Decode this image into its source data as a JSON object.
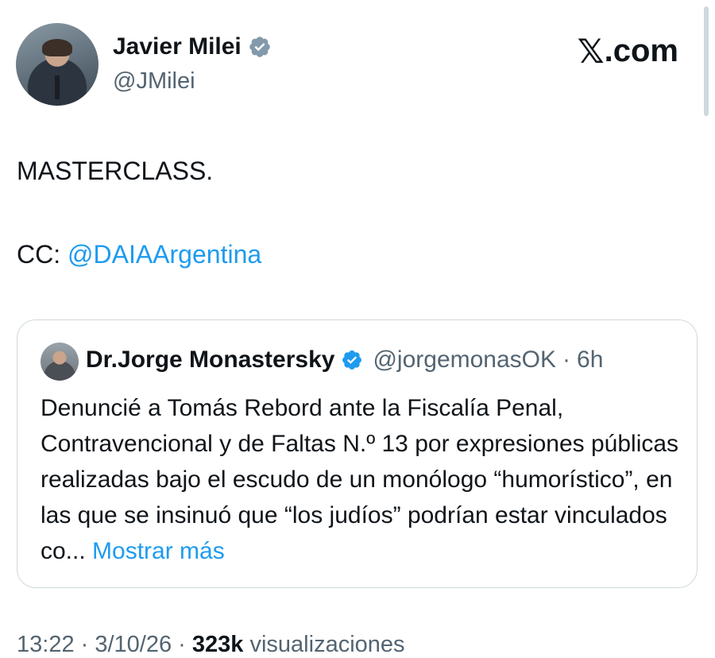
{
  "header": {
    "display_name": "Javier Milei",
    "handle": "@JMilei",
    "brand": ".com",
    "brand_mark": "𝕏",
    "verified_color": "#1d9bf0"
  },
  "tweet": {
    "line1": "MASTERCLASS.",
    "cc_prefix": "CC: ",
    "mention": "@DAIAArgentina"
  },
  "quote": {
    "display_name": "Dr.Jorge Monastersky",
    "handle": "@jorgemonasOK",
    "separator": "·",
    "time": "6h",
    "text": "Denuncié a Tomás Rebord ante la Fiscalía Penal, Contravencional y de Faltas N.º 13 por expresiones públicas realizadas bajo el escudo de un monólogo “humorístico”, en las que se insinuó que “los judíos” podrían estar vinculados co...",
    "show_more": "Mostrar más"
  },
  "footer": {
    "time": "13:22",
    "sep1": " · ",
    "date": "3/10/26",
    "sep2": " · ",
    "views_count": "323k",
    "views_label": " visualizaciones"
  },
  "icons": {
    "verified": "verified-badge-icon",
    "brand": "x-logo-icon"
  },
  "colors": {
    "accent": "#1d9bf0",
    "muted": "#536471",
    "text": "#0f1419"
  }
}
